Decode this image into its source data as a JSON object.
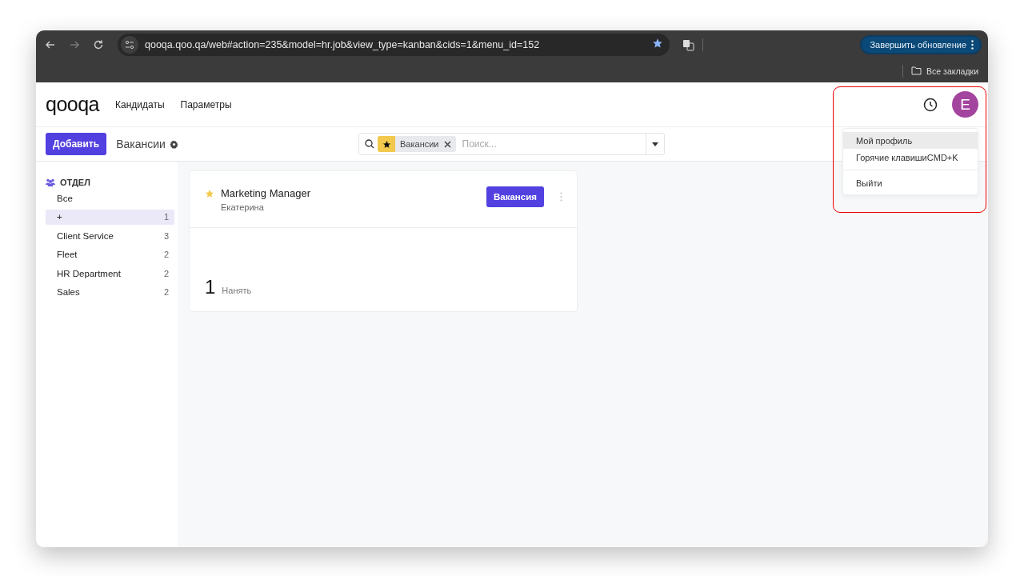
{
  "browser": {
    "url": "qooqa.qoo.qa/web#action=235&model=hr.job&view_type=kanban&cids=1&menu_id=152",
    "bookmarked": true,
    "update_button": "Завершить обновление",
    "bookmarks_folder": "Все закладки"
  },
  "navbar": {
    "logo": "qooqa",
    "menu": [
      "Кандидаты",
      "Параметры"
    ],
    "avatar": "E"
  },
  "control_panel": {
    "new_button": "Добавить",
    "breadcrumb": "Вакансии",
    "search": {
      "facet": "Вакансии",
      "placeholder": "Поиск..."
    }
  },
  "sidebar": {
    "title": "ОТДЕЛ",
    "items": [
      {
        "label": "Все",
        "selected": false
      },
      {
        "label": "+",
        "count": "1",
        "selected": true
      },
      {
        "label": "Client Service",
        "count": "3",
        "selected": false
      },
      {
        "label": "Fleet",
        "count": "2",
        "selected": false
      },
      {
        "label": "HR Department",
        "count": "2",
        "selected": false
      },
      {
        "label": "Sales",
        "count": "2",
        "selected": false
      }
    ]
  },
  "cards": [
    {
      "title": "Marketing Manager",
      "favorite": true,
      "subtitle": "Екатерина",
      "button": "Вакансия",
      "count": "1",
      "count_label": "Нанять"
    }
  ],
  "user_menu": {
    "items": [
      {
        "label": "Мой профиль",
        "selected": true
      },
      {
        "label": "Горячие клавишиCMD+K",
        "selected": false
      },
      {
        "label": "Выйти",
        "selected": false
      }
    ]
  }
}
